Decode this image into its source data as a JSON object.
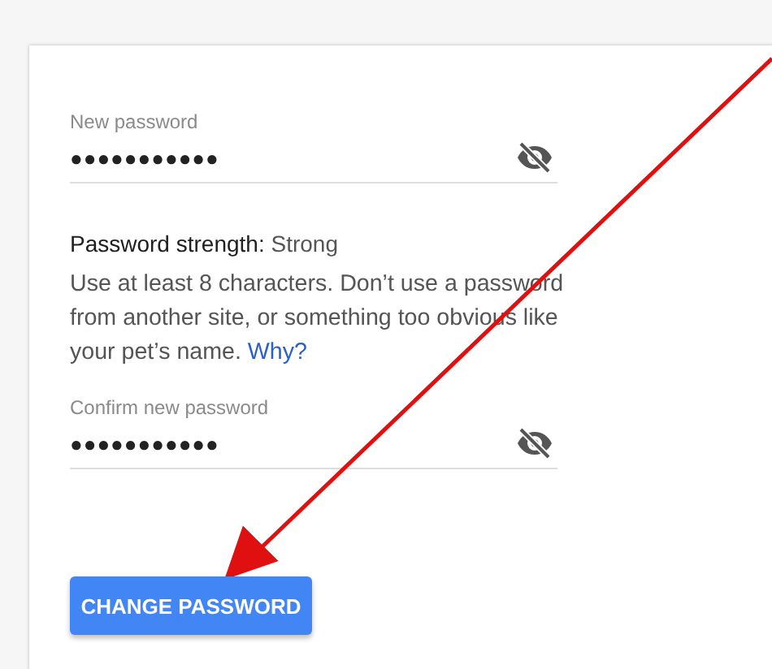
{
  "fields": [
    {
      "label": "New password",
      "value": "●●●●●●●●●●●",
      "masked": true
    }
  ],
  "strength": {
    "label": "Password strength:",
    "value": "Strong"
  },
  "help": {
    "text": "Use at least 8 characters. Don’t use a password from another site, or something too obvious like your pet’s name.",
    "link": "Why?"
  },
  "confirm": {
    "label": "Confirm new password",
    "value": "●●●●●●●●●●●",
    "masked": true
  },
  "button": "CHANGE PASSWORD"
}
